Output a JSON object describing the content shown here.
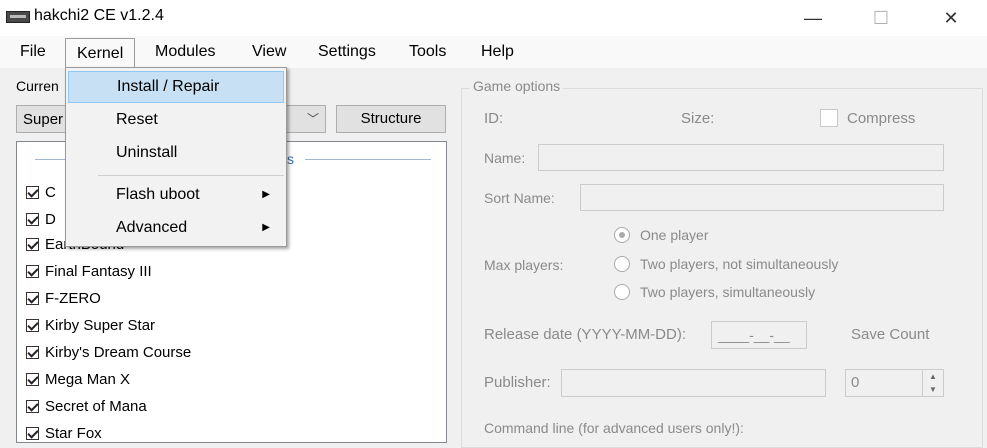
{
  "window": {
    "title": "hakchi2 CE v1.2.4",
    "minimize": "—",
    "maximize": "☐",
    "close": "✕"
  },
  "menubar": [
    "File",
    "Kernel",
    "Modules",
    "View",
    "Settings",
    "Tools",
    "Help"
  ],
  "left": {
    "current_label": "Curren",
    "preset_value": "Super",
    "structure_button": "Structure",
    "group_label": "s",
    "games": [
      {
        "name": "C",
        "checked": true
      },
      {
        "name": "D",
        "checked": true
      },
      {
        "name": "EarthBound",
        "checked": true
      },
      {
        "name": "Final Fantasy III",
        "checked": true
      },
      {
        "name": "F-ZERO",
        "checked": true
      },
      {
        "name": "Kirby Super Star",
        "checked": true
      },
      {
        "name": "Kirby's Dream Course",
        "checked": true
      },
      {
        "name": "Mega Man X",
        "checked": true
      },
      {
        "name": "Secret of Mana",
        "checked": true
      },
      {
        "name": "Star Fox",
        "checked": true
      }
    ]
  },
  "game_options": {
    "title": "Game options",
    "id_label": "ID:",
    "size_label": "Size:",
    "compress_label": "Compress",
    "name_label": "Name:",
    "sort_name_label": "Sort Name:",
    "max_players_label": "Max players:",
    "players": [
      {
        "label": "One player",
        "selected": true
      },
      {
        "label": "Two players, not simultaneously",
        "selected": false
      },
      {
        "label": "Two players, simultaneously",
        "selected": false
      }
    ],
    "release_label": "Release date (YYYY-MM-DD):",
    "release_value": "____-__-__",
    "save_count_label": "Save Count",
    "save_count_value": "0",
    "publisher_label": "Publisher:",
    "command_line_label": "Command line (for advanced users only!):"
  },
  "kernel_menu": [
    {
      "label": "Install / Repair",
      "highlighted": true,
      "submenu": false
    },
    {
      "label": "Reset",
      "highlighted": false,
      "submenu": false
    },
    {
      "label": "Uninstall",
      "highlighted": false,
      "submenu": false
    },
    {
      "label": "Flash uboot",
      "highlighted": false,
      "submenu": true
    },
    {
      "label": "Advanced",
      "highlighted": false,
      "submenu": true
    }
  ],
  "icons": {
    "submenu_arrow": "▶",
    "spinner_up": "▲",
    "spinner_down": "▼",
    "combo_arrow": "﹀"
  }
}
